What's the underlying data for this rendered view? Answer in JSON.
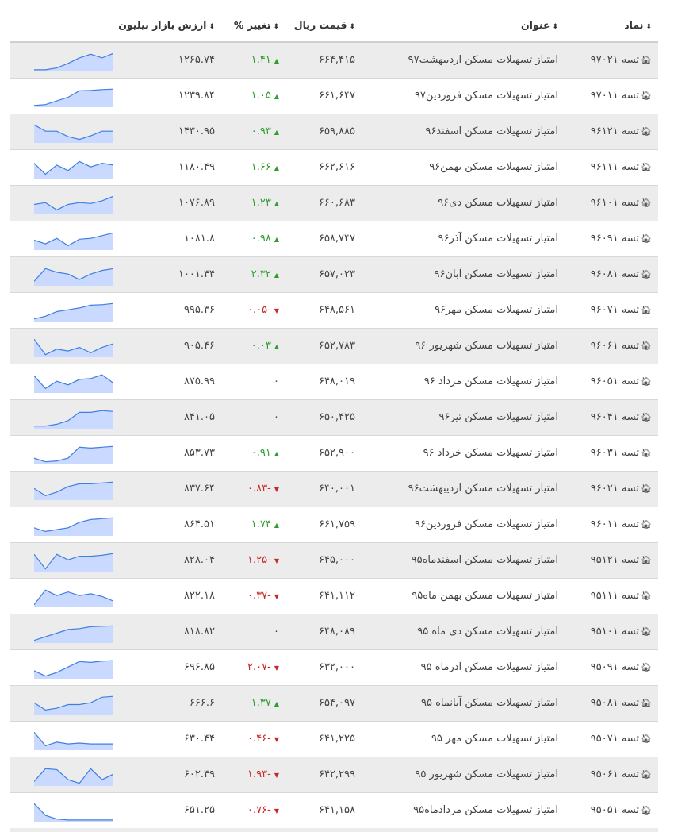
{
  "header": {
    "symbol": "نماد",
    "title": "عنوان",
    "price": "قیمت ریال",
    "change": "تغییر %",
    "market_cap": "ارزش بازار بیلیون"
  },
  "colors": {
    "up": "#2e9e2e",
    "down": "#c62828",
    "spark_fill": "#c9d9ff",
    "spark_line": "#3f7fe0",
    "row_alt": "#ececec"
  },
  "icons": {
    "symbol_icon": "home-icon",
    "sort_icon": "sort-icon",
    "up_icon": "triangle-up-icon",
    "down_icon": "triangle-down-icon"
  },
  "rows": [
    {
      "symbol": "تسه ۹۷۰۲۱",
      "title": "امتیاز تسهیلات مسکن اردیبهشت۹۷",
      "price": "۶۶۴,۴۱۵",
      "change": "۱.۴۱",
      "trend": "up",
      "market_cap": "۱۲۶۵.۷۴",
      "spark": [
        0.05,
        0.05,
        0.15,
        0.4,
        0.7,
        0.9,
        0.7,
        0.95
      ]
    },
    {
      "symbol": "تسه ۹۷۰۱۱",
      "title": "امتیاز تسهیلات مسکن فروردین۹۷",
      "price": "۶۶۱,۶۴۷",
      "change": "۱.۰۵",
      "trend": "up",
      "market_cap": "۱۲۳۹.۸۴",
      "spark": [
        0.05,
        0.1,
        0.3,
        0.5,
        0.85,
        0.88,
        0.92,
        0.95
      ]
    },
    {
      "symbol": "تسه ۹۶۱۲۱",
      "title": "امتیاز تسهیلات مسکن اسفند۹۶",
      "price": "۶۵۹,۸۸۵",
      "change": "۰.۹۳",
      "trend": "up",
      "market_cap": "۱۴۳۰.۹۵",
      "spark": [
        0.95,
        0.6,
        0.6,
        0.3,
        0.15,
        0.35,
        0.6,
        0.6
      ]
    },
    {
      "symbol": "تسه ۹۶۱۱۱",
      "title": "امتیاز تسهیلات مسکن بهمن۹۶",
      "price": "۶۶۲,۶۱۶",
      "change": "۱.۶۶",
      "trend": "up",
      "market_cap": "۱۱۸۰.۴۹",
      "spark": [
        0.8,
        0.2,
        0.7,
        0.4,
        0.9,
        0.6,
        0.8,
        0.7
      ]
    },
    {
      "symbol": "تسه ۹۶۱۰۱",
      "title": "امتیاز تسهیلات مسکن دی۹۶",
      "price": "۶۶۰,۶۸۳",
      "change": "۱.۲۳",
      "trend": "up",
      "market_cap": "۱۰۷۶.۸۹",
      "spark": [
        0.5,
        0.6,
        0.2,
        0.5,
        0.6,
        0.55,
        0.7,
        0.95
      ]
    },
    {
      "symbol": "تسه ۹۶۰۹۱",
      "title": "امتیاز تسهیلات مسکن آذر۹۶",
      "price": "۶۵۸,۷۴۷",
      "change": "۰.۹۸",
      "trend": "up",
      "market_cap": "۱۰۸۱.۸",
      "spark": [
        0.5,
        0.3,
        0.6,
        0.2,
        0.55,
        0.6,
        0.75,
        0.9
      ]
    },
    {
      "symbol": "تسه ۹۶۰۸۱",
      "title": "امتیاز تسهیلات مسکن آبان۹۶",
      "price": "۶۵۷,۰۲۳",
      "change": "۲.۳۲",
      "trend": "up",
      "market_cap": "۱۰۰۱.۴۴",
      "spark": [
        0.2,
        0.9,
        0.7,
        0.6,
        0.3,
        0.6,
        0.8,
        0.9
      ]
    },
    {
      "symbol": "تسه ۹۶۰۷۱",
      "title": "امتیاز تسهیلات مسکن مهر۹۶",
      "price": "۶۴۸,۵۶۱",
      "change": "-۰.۰۵",
      "trend": "down",
      "market_cap": "۹۹۵.۳۶",
      "spark": [
        0.1,
        0.25,
        0.5,
        0.6,
        0.7,
        0.85,
        0.88,
        0.95
      ]
    },
    {
      "symbol": "تسه ۹۶۰۶۱",
      "title": "امتیاز تسهیلات مسکن شهریور ۹۶",
      "price": "۶۵۲,۷۸۳",
      "change": "۰.۰۳",
      "trend": "up",
      "market_cap": "۹۰۵.۴۶",
      "spark": [
        0.95,
        0.1,
        0.4,
        0.3,
        0.5,
        0.2,
        0.5,
        0.7
      ]
    },
    {
      "symbol": "تسه ۹۶۰۵۱",
      "title": "امتیاز تسهیلات مسکن مرداد ۹۶",
      "price": "۶۴۸,۰۱۹",
      "change": "۰",
      "trend": "neutral",
      "market_cap": "۸۷۵.۹۹",
      "spark": [
        0.9,
        0.2,
        0.6,
        0.4,
        0.7,
        0.75,
        0.95,
        0.5
      ]
    },
    {
      "symbol": "تسه ۹۶۰۴۱",
      "title": "امتیاز تسهیلات مسکن تیر۹۶",
      "price": "۶۵۰,۴۲۵",
      "change": "۰",
      "trend": "neutral",
      "market_cap": "۸۴۱.۰۵",
      "spark": [
        0.1,
        0.1,
        0.2,
        0.4,
        0.85,
        0.85,
        0.95,
        0.9
      ]
    },
    {
      "symbol": "تسه ۹۶۰۳۱",
      "title": "امتیاز تسهیلات مسکن خرداد ۹۶",
      "price": "۶۵۲,۹۰۰",
      "change": "۰.۹۱",
      "trend": "up",
      "market_cap": "۸۵۳.۷۳",
      "spark": [
        0.3,
        0.1,
        0.15,
        0.3,
        0.9,
        0.85,
        0.9,
        0.95
      ]
    },
    {
      "symbol": "تسه ۹۶۰۲۱",
      "title": "امتیاز تسهیلات مسکن اردیبهشت۹۶",
      "price": "۶۴۰,۰۰۱",
      "change": "-۰.۸۳",
      "trend": "down",
      "market_cap": "۸۳۷.۶۴",
      "spark": [
        0.6,
        0.2,
        0.4,
        0.7,
        0.85,
        0.85,
        0.9,
        0.95
      ]
    },
    {
      "symbol": "تسه ۹۶۰۱۱",
      "title": "امتیاز تسهیلات مسکن فروردین۹۶",
      "price": "۶۶۱,۷۵۹",
      "change": "۱.۷۴",
      "trend": "up",
      "market_cap": "۸۶۴.۵۱",
      "spark": [
        0.4,
        0.2,
        0.3,
        0.4,
        0.7,
        0.85,
        0.9,
        0.95
      ]
    },
    {
      "symbol": "تسه ۹۵۱۲۱",
      "title": "امتیاز تسهیلات مسکن اسفندماه۹۵",
      "price": "۶۴۵,۰۰۰",
      "change": "-۱.۲۵",
      "trend": "down",
      "market_cap": "۸۲۸.۰۴",
      "spark": [
        0.9,
        0.1,
        0.9,
        0.6,
        0.8,
        0.8,
        0.85,
        0.95
      ]
    },
    {
      "symbol": "تسه ۹۵۱۱۱",
      "title": "امتیاز تسهیلات مسکن بهمن ماه۹۵",
      "price": "۶۴۱,۱۱۲",
      "change": "-۰.۳۷",
      "trend": "down",
      "market_cap": "۸۲۲.۱۸",
      "spark": [
        0.1,
        0.9,
        0.6,
        0.8,
        0.6,
        0.7,
        0.55,
        0.3
      ]
    },
    {
      "symbol": "تسه ۹۵۱۰۱",
      "title": "امتیاز تسهیلات مسکن دی ماه ۹۵",
      "price": "۶۴۸,۰۸۹",
      "change": "۰",
      "trend": "neutral",
      "market_cap": "۸۱۸.۸۲",
      "spark": [
        0.1,
        0.3,
        0.5,
        0.7,
        0.75,
        0.85,
        0.88,
        0.9
      ]
    },
    {
      "symbol": "تسه ۹۵۰۹۱",
      "title": "امتیاز تسهیلات مسکن آذرماه ۹۵",
      "price": "۶۳۲,۰۰۰",
      "change": "-۲.۰۷",
      "trend": "down",
      "market_cap": "۶۹۶.۸۵",
      "spark": [
        0.4,
        0.1,
        0.3,
        0.6,
        0.9,
        0.85,
        0.92,
        0.95
      ]
    },
    {
      "symbol": "تسه ۹۵۰۸۱",
      "title": "امتیاز تسهیلات مسکن آبانماه ۹۵",
      "price": "۶۵۴,۰۹۷",
      "change": "۱.۳۷",
      "trend": "up",
      "market_cap": "۶۶۶.۶",
      "spark": [
        0.6,
        0.2,
        0.3,
        0.5,
        0.5,
        0.6,
        0.9,
        0.95
      ]
    },
    {
      "symbol": "تسه ۹۵۰۷۱",
      "title": "امتیاز تسهیلات مسکن مهر ۹۵",
      "price": "۶۴۱,۲۲۵",
      "change": "-۰.۴۶",
      "trend": "down",
      "market_cap": "۶۳۰.۴۴",
      "spark": [
        0.95,
        0.2,
        0.4,
        0.3,
        0.35,
        0.3,
        0.3,
        0.3
      ]
    },
    {
      "symbol": "تسه ۹۵۰۶۱",
      "title": "امتیاز تسهیلات مسکن شهریور ۹۵",
      "price": "۶۴۲,۲۹۹",
      "change": "-۱.۹۳",
      "trend": "down",
      "market_cap": "۶۰۲.۴۹",
      "spark": [
        0.2,
        0.9,
        0.85,
        0.3,
        0.1,
        0.9,
        0.3,
        0.6
      ]
    },
    {
      "symbol": "تسه ۹۵۰۵۱",
      "title": "امتیاز تسهیلات مسکن مردادماه۹۵",
      "price": "۶۴۱,۱۵۸",
      "change": "-۰.۷۶",
      "trend": "down",
      "market_cap": "۶۵۱.۲۵",
      "spark": [
        0.95,
        0.3,
        0.1,
        0.05,
        0.05,
        0.05,
        0.05,
        0.05
      ]
    }
  ]
}
